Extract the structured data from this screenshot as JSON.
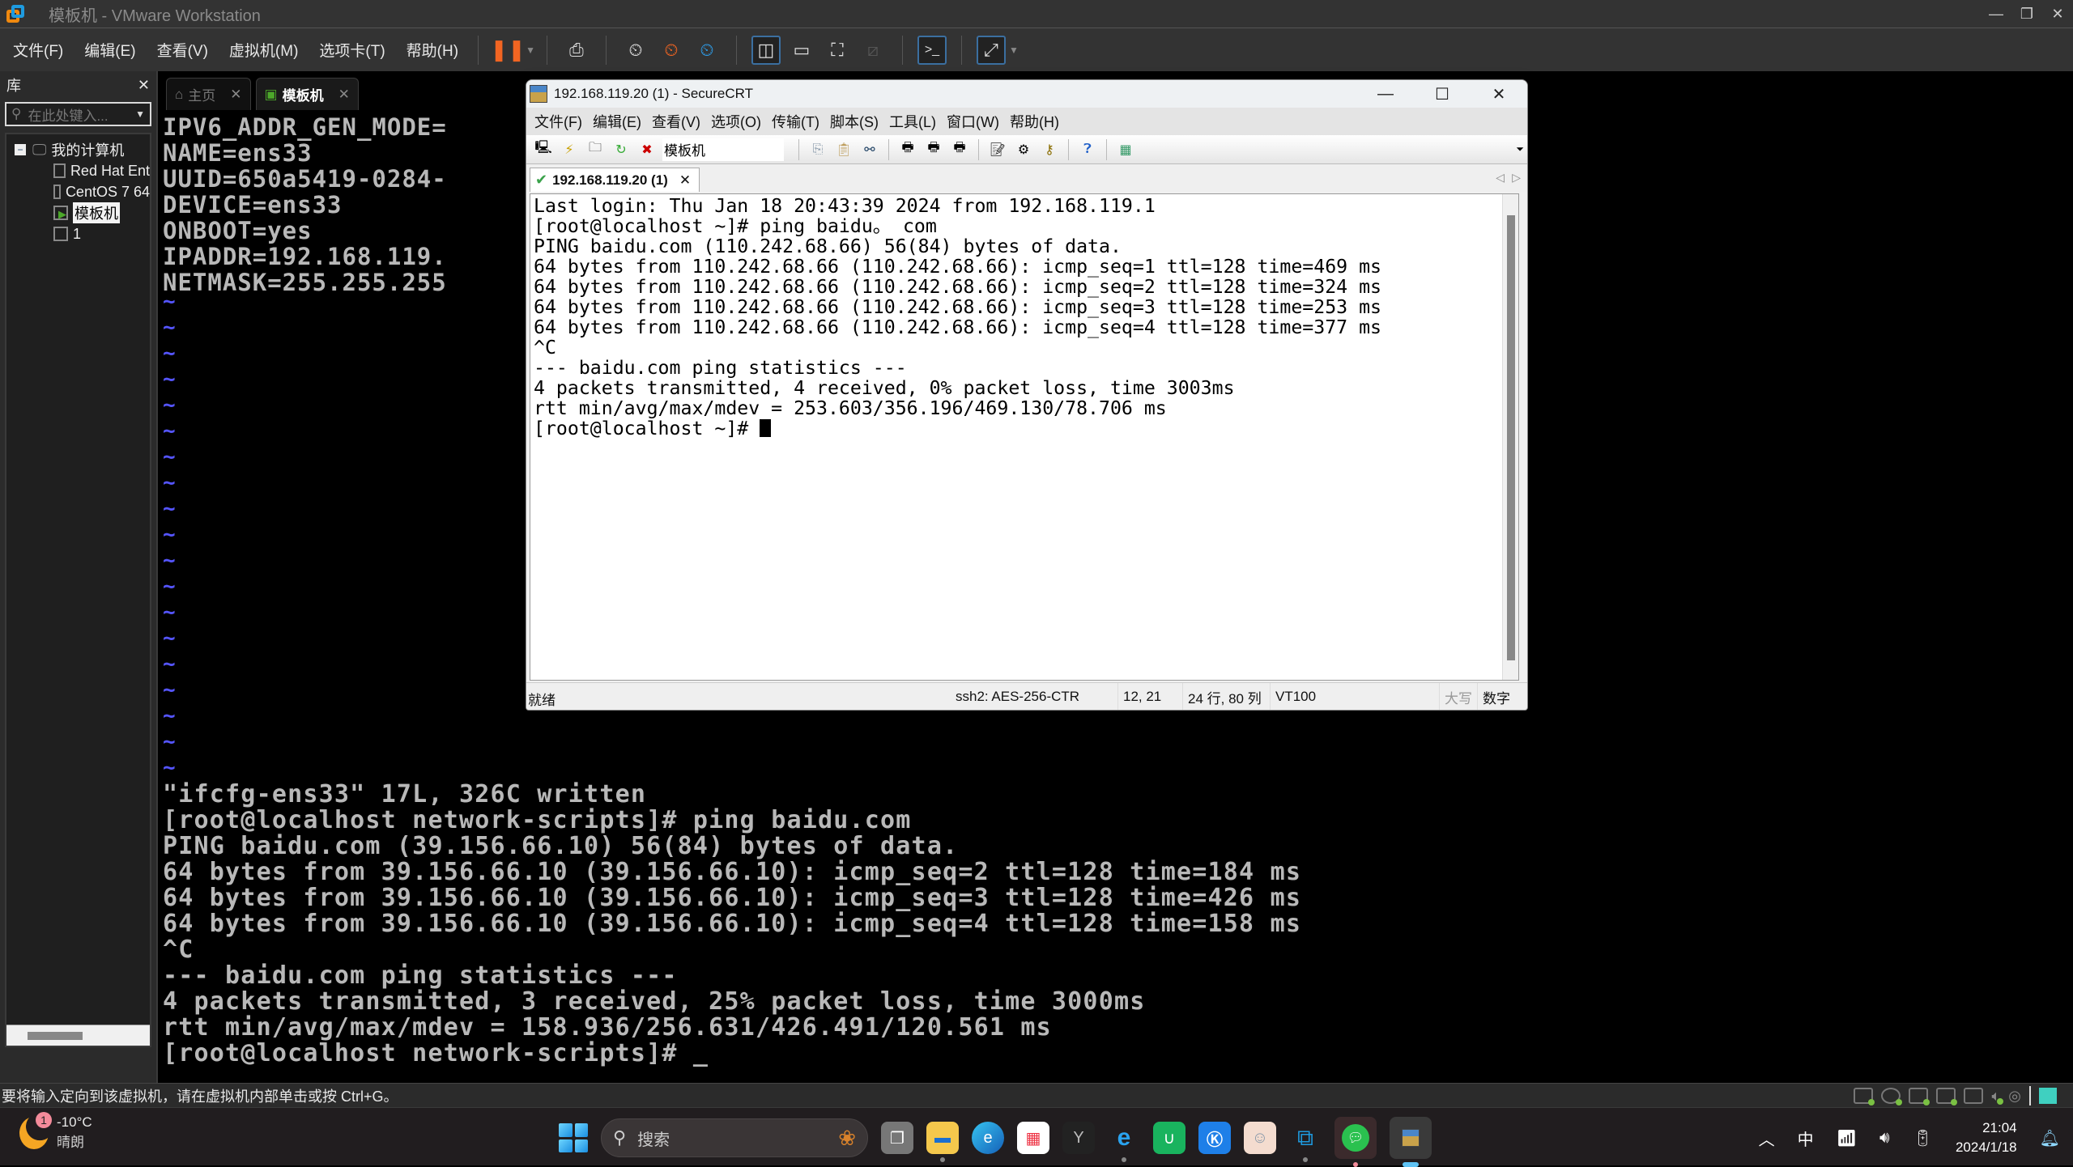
{
  "vmware": {
    "title": "模板机 - VMware Workstation",
    "menu": [
      "文件(F)",
      "编辑(E)",
      "查看(V)",
      "虚拟机(M)",
      "选项卡(T)",
      "帮助(H)"
    ],
    "toolbar_icons": [
      "pause-icon",
      "send-ctrl-alt-del-icon",
      "snapshot-take-icon",
      "snapshot-revert-icon",
      "snapshot-manager-icon",
      "show-library-icon",
      "thumbnail-bar-icon",
      "full-screen-icon",
      "unity-icon",
      "console-view-icon",
      "stretch-guest-icon"
    ],
    "library": {
      "title": "库",
      "search_placeholder": "在此处键入...",
      "tree": [
        {
          "label": "我的计算机",
          "level": 0
        },
        {
          "label": "Red Hat Ent",
          "level": 1
        },
        {
          "label": "CentOS 7 64",
          "level": 1
        },
        {
          "label": "模板机",
          "level": 1,
          "selected": true,
          "running": true
        },
        {
          "label": "1",
          "level": 1
        }
      ]
    },
    "tabs": [
      {
        "label": "主页",
        "active": false
      },
      {
        "label": "模板机",
        "active": true
      }
    ],
    "console_top": [
      "IPV6_ADDR_GEN_MODE=",
      "NAME=ens33",
      "UUID=650a5419-0284-",
      "DEVICE=ens33",
      "ONBOOT=yes",
      "IPADDR=192.168.119.",
      "NETMASK=255.255.255"
    ],
    "tilde_count": 19,
    "console_bottom": [
      "\"ifcfg-ens33\" 17L, 326C written",
      "[root@localhost network-scripts]# ping baidu.com",
      "PING baidu.com (39.156.66.10) 56(84) bytes of data.",
      "64 bytes from 39.156.66.10 (39.156.66.10): icmp_seq=2 ttl=128 time=184 ms",
      "64 bytes from 39.156.66.10 (39.156.66.10): icmp_seq=3 ttl=128 time=426 ms",
      "64 bytes from 39.156.66.10 (39.156.66.10): icmp_seq=4 ttl=128 time=158 ms",
      "^C",
      "--- baidu.com ping statistics ---",
      "4 packets transmitted, 3 received, 25% packet loss, time 3000ms",
      "rtt min/avg/max/mdev = 158.936/256.631/426.491/120.561 ms",
      "[root@localhost network-scripts]# _"
    ],
    "status_text": "要将输入定向到该虚拟机，请在虚拟机内部单击或按 Ctrl+G。"
  },
  "securecrt": {
    "title": "192.168.119.20 (1) - SecureCRT",
    "menu": [
      "文件(F)",
      "编辑(E)",
      "查看(V)",
      "选项(O)",
      "传输(T)",
      "脚本(S)",
      "工具(L)",
      "窗口(W)",
      "帮助(H)"
    ],
    "session_box": "模板机",
    "tab_label": "192.168.119.20 (1)",
    "terminal": [
      "Last login: Thu Jan 18 20:43:39 2024 from 192.168.119.1",
      "[root@localhost ~]# ping baidu。 com",
      "PING baidu.com (110.242.68.66) 56(84) bytes of data.",
      "64 bytes from 110.242.68.66 (110.242.68.66): icmp_seq=1 ttl=128 time=469 ms",
      "64 bytes from 110.242.68.66 (110.242.68.66): icmp_seq=2 ttl=128 time=324 ms",
      "64 bytes from 110.242.68.66 (110.242.68.66): icmp_seq=3 ttl=128 time=253 ms",
      "64 bytes from 110.242.68.66 (110.242.68.66): icmp_seq=4 ttl=128 time=377 ms",
      "^C",
      "--- baidu.com ping statistics ---",
      "4 packets transmitted, 4 received, 0% packet loss, time 3003ms",
      "rtt min/avg/max/mdev = 253.603/356.196/469.130/78.706 ms",
      "[root@localhost ~]# "
    ],
    "status": {
      "ready": "就绪",
      "cipher": "ssh2: AES-256-CTR",
      "cursor_pos": "12, 21",
      "size": "24 行, 80 列",
      "emulation": "VT100",
      "caps": "大写",
      "num": "数字"
    }
  },
  "taskbar": {
    "weather_temp": "-10°C",
    "weather_desc": "晴朗",
    "weather_badge": "1",
    "search_label": "搜索",
    "apps": [
      "task-view",
      "file-explorer",
      "edge",
      "microsoft-store",
      "game-center",
      "browser",
      "green-app",
      "k-app",
      "anime-app",
      "vmware",
      "wechat",
      "securecrt"
    ],
    "ime": "中",
    "time": "21:04",
    "date": "2024/1/18"
  }
}
